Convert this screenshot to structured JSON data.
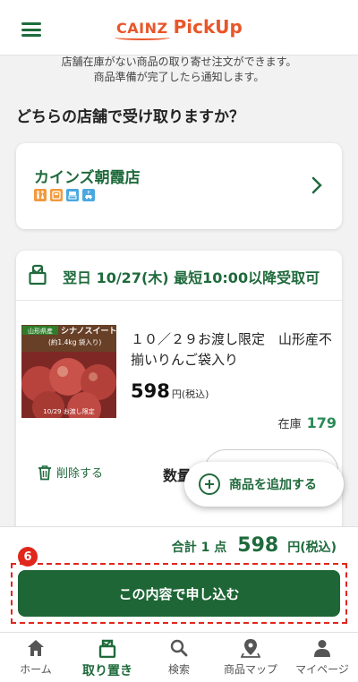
{
  "header": {
    "logo_brand": "CAINZ",
    "logo_product": "PickUp"
  },
  "notice": {
    "line1": "店舗在庫がない商品の取り寄せ注文ができます。",
    "line2": "商品準備が完了したら通知します。"
  },
  "question": "どちらの店舗で受け取りますか？",
  "store": {
    "name": "カインズ朝霞店",
    "facility_icons": [
      "restroom-icon",
      "atm-icon",
      "service-counter-icon",
      "parking-icon"
    ]
  },
  "pickup": {
    "date_label": "翌日 10/27(木) 最短10:00以降受取可",
    "product": {
      "name": "１０／２９お渡し限定　山形産不揃いりんご袋入り",
      "image_text": {
        "region": "山形県産",
        "variety": "シナノスイート",
        "weight": "(約1.4kg 袋入り)",
        "limited": "10/29 お渡し限定"
      },
      "price": "598",
      "price_unit": "円(税込)",
      "stock_label": "在庫",
      "stock_value": "179"
    },
    "delete_label": "削除する",
    "qty_label": "数量"
  },
  "add_button": "商品を追加する",
  "summary": {
    "total_label": "合計 1 点",
    "total_price": "598",
    "total_unit": "円(税込)",
    "step_number": "6",
    "submit_label": "この内容で申し込む"
  },
  "nav": [
    {
      "label": "ホーム",
      "icon": "home-icon"
    },
    {
      "label": "取り置き",
      "icon": "pickup-bag-icon"
    },
    {
      "label": "検索",
      "icon": "search-icon"
    },
    {
      "label": "商品マップ",
      "icon": "map-pin-icon"
    },
    {
      "label": "マイページ",
      "icon": "user-icon"
    }
  ],
  "colors": {
    "brand_orange": "#e8562a",
    "brand_green": "#1f6a3c",
    "highlight_red": "#e1261c"
  }
}
